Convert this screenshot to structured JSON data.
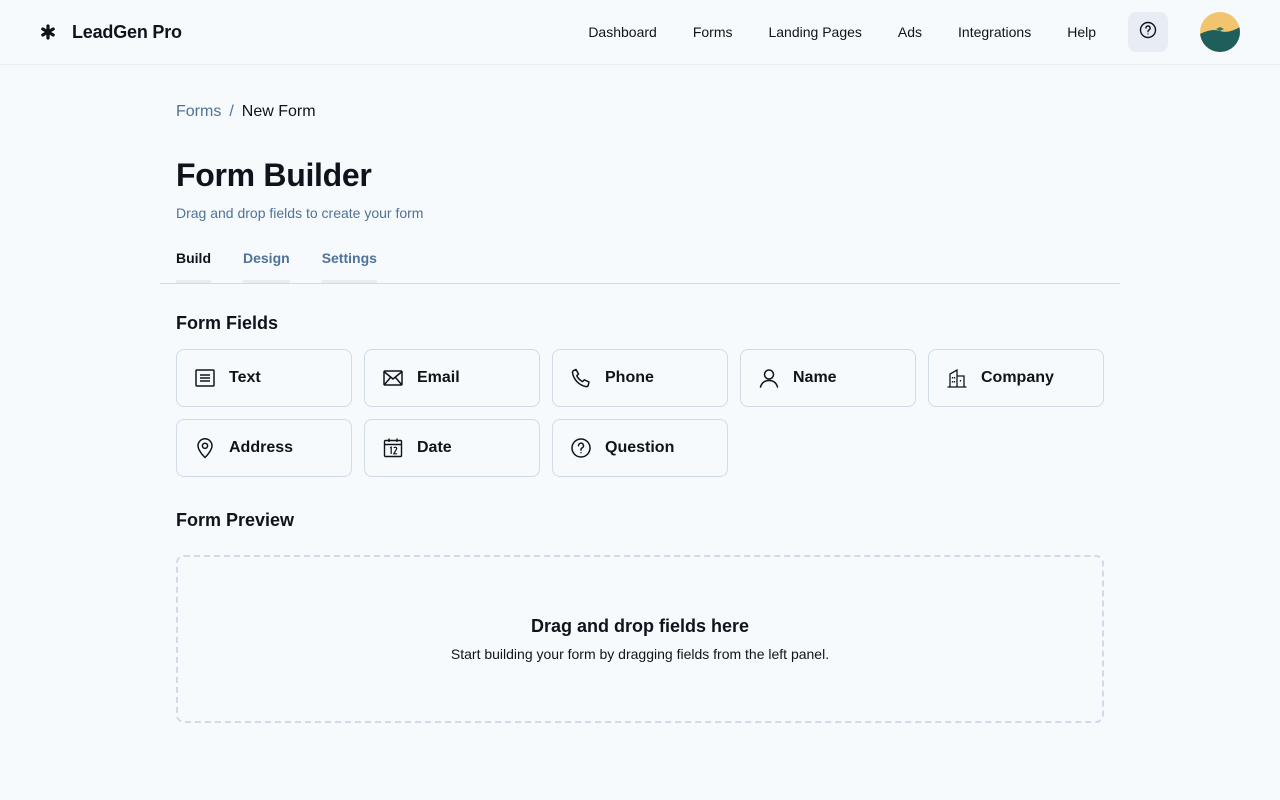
{
  "brand": {
    "name": "LeadGen Pro",
    "logo_icon": "asterisk-logo-icon"
  },
  "nav": {
    "links": [
      "Dashboard",
      "Forms",
      "Landing Pages",
      "Ads",
      "Integrations",
      "Help"
    ],
    "help_icon": "question-circle-icon",
    "avatar_icon": "user-avatar"
  },
  "breadcrumb": {
    "parent": "Forms",
    "separator": "/",
    "current": "New Form"
  },
  "page": {
    "title": "Form Builder",
    "subtitle": "Drag and drop fields to create your form"
  },
  "tabs": [
    {
      "label": "Build",
      "active": true
    },
    {
      "label": "Design",
      "active": false
    },
    {
      "label": "Settings",
      "active": false
    }
  ],
  "form_fields": {
    "title": "Form Fields",
    "items": [
      {
        "label": "Text",
        "icon": "text-lines-icon"
      },
      {
        "label": "Email",
        "icon": "envelope-icon"
      },
      {
        "label": "Phone",
        "icon": "phone-icon"
      },
      {
        "label": "Name",
        "icon": "user-icon"
      },
      {
        "label": "Company",
        "icon": "building-icon"
      },
      {
        "label": "Address",
        "icon": "map-pin-icon"
      },
      {
        "label": "Date",
        "icon": "calendar-icon"
      },
      {
        "label": "Question",
        "icon": "question-circle-icon"
      }
    ]
  },
  "preview": {
    "title": "Form Preview",
    "drop_title": "Drag and drop fields here",
    "drop_subtitle": "Start building your form by dragging fields from the left panel."
  },
  "colors": {
    "background": "#f7fafc",
    "text": "#0e141b",
    "muted": "#4e7397",
    "border": "#d0dbe7",
    "surface": "#e7edf3",
    "avatar_sun": "#f2c46d",
    "avatar_hill": "#1f5f5b"
  }
}
